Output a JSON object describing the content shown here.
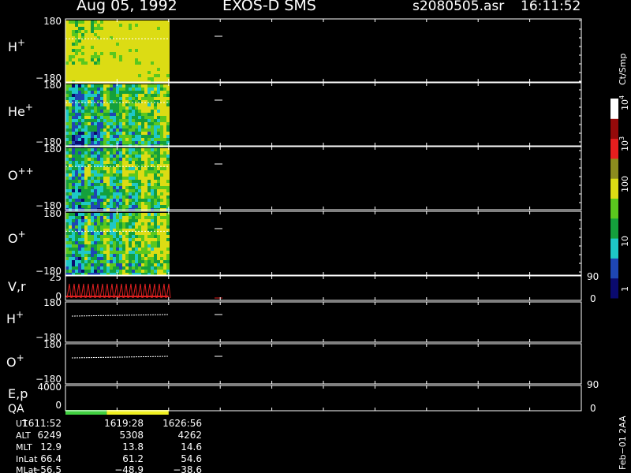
{
  "header": {
    "date": "Aug 05, 1992",
    "instrument": "EXOS-D SMS",
    "file": "s2080505.asr",
    "time": "16:11:52"
  },
  "panels": [
    {
      "id": "H+",
      "label": "H",
      "sup": "+",
      "ymax": "180",
      "ymin": "−180"
    },
    {
      "id": "He+",
      "label": "He",
      "sup": "+",
      "ymax": "180",
      "ymin": "−180"
    },
    {
      "id": "O++",
      "label": "O",
      "sup": "++",
      "ymax": "180",
      "ymin": "−180"
    },
    {
      "id": "O+",
      "label": "O",
      "sup": "+",
      "ymax": "180",
      "ymin": "−180"
    }
  ],
  "vr_panel": {
    "label": "V,r",
    "ymax": "25",
    "ymin": "0",
    "right_max": "90",
    "right_min": "0"
  },
  "small_panels": [
    {
      "id": "H+ line",
      "label": "H",
      "sup": "+",
      "ymax": "180",
      "ymin": "−180"
    },
    {
      "id": "O+ line",
      "label": "O",
      "sup": "+",
      "ymax": "180",
      "ymin": "−180"
    }
  ],
  "ep_panel": {
    "label": "E,p",
    "ymax": "4000",
    "ymin": "0",
    "right_max": "90",
    "right_min": "0"
  },
  "qa_panel": {
    "label": "QA"
  },
  "colorbar": {
    "unit": "Ct/Smp",
    "ticks": [
      "1",
      "10",
      "100",
      "10",
      "10"
    ],
    "exponents": [
      "",
      "",
      "",
      "3",
      "4"
    ]
  },
  "side_note": "Feb−01 2AA",
  "ephemeris": {
    "labels": [
      "UT",
      "ALT",
      "MLT",
      "InLat",
      "MLat"
    ],
    "columns": [
      [
        "1611:52",
        "6249",
        "12.9",
        "66.4",
        "−56.5"
      ],
      [
        "1619:28",
        "5308",
        "13.8",
        "61.2",
        "−48.9"
      ],
      [
        "1626:56",
        "4262",
        "14.6",
        "54.6",
        "−38.6"
      ]
    ]
  },
  "chart_data": {
    "type": "heatmap",
    "title": "Aug 05, 1992   EXOS-D SMS",
    "x_ticks_ut": [
      "1611:52",
      "1619:28",
      "1626:56"
    ],
    "data_coverage_fraction": 0.2,
    "colorbar_range": [
      1,
      10000
    ],
    "colorbar_scale": "log",
    "colorbar_colors": [
      "#0a0a6e",
      "#1e46b4",
      "#1ec8c8",
      "#14a03c",
      "#5ac81e",
      "#dcdc14",
      "#8c8c1e",
      "#e61e1e",
      "#960a0a",
      "#ffffff"
    ],
    "panels_y_range": [
      -180,
      180
    ],
    "qa_segments": [
      {
        "fraction": 0.4,
        "color": "#40d040"
      },
      {
        "fraction": 0.6,
        "color": "#f0f020"
      }
    ]
  }
}
